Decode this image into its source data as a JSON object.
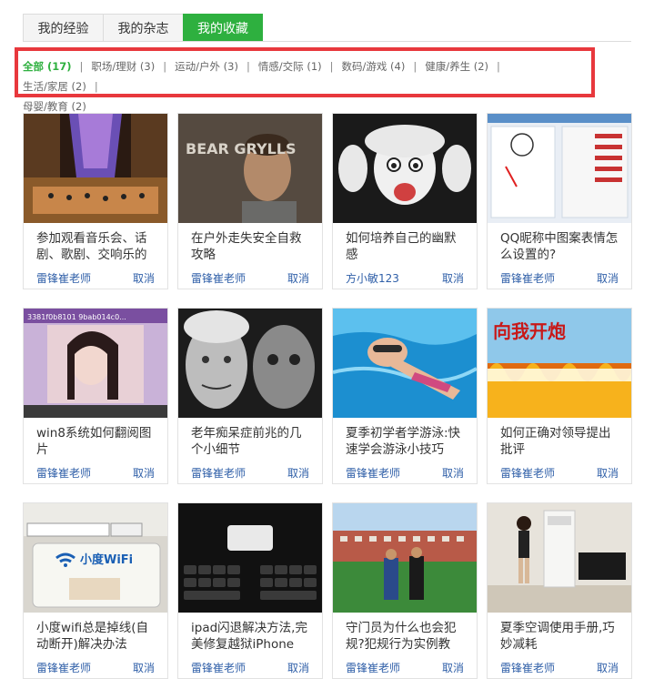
{
  "tabs": [
    {
      "label": "我的经验",
      "active": false
    },
    {
      "label": "我的杂志",
      "active": false
    },
    {
      "label": "我的收藏",
      "active": true
    }
  ],
  "categories": [
    {
      "label": "全部 (17)",
      "active": true
    },
    {
      "label": "职场/理财 (3)"
    },
    {
      "label": "运动/户外 (3)"
    },
    {
      "label": "情感/交际 (1)"
    },
    {
      "label": "数码/游戏 (4)"
    },
    {
      "label": "健康/养生 (2)"
    },
    {
      "label": "生活/家居 (2)"
    },
    {
      "label": "母婴/教育 (2)"
    }
  ],
  "cards": [
    {
      "title": "参加观看音乐会、话剧、歌剧、交响乐的",
      "author": "雷锋崔老师",
      "cancel": "取消",
      "thumb": "concert-photo"
    },
    {
      "title": "在户外走失安全自救攻略",
      "author": "雷锋崔老师",
      "cancel": "取消",
      "thumb": "bear-grylls-photo",
      "thumb_text": "BEAR GRYLLS"
    },
    {
      "title": "如何培养自己的幽默感",
      "author": "方小敏123",
      "cancel": "取消",
      "thumb": "einstein-cartoon"
    },
    {
      "title": "QQ昵称中图案表情怎么设置的?",
      "author": "雷锋崔老师",
      "cancel": "取消",
      "thumb": "qq-screenshot"
    },
    {
      "title": "win8系统如何翻阅图片",
      "author": "雷锋崔老师",
      "cancel": "取消",
      "thumb": "win8-photo-viewer",
      "thumb_text": "3381f0b8101 9bab014c0..."
    },
    {
      "title": "老年痴呆症前兆的几个小细节",
      "author": "雷锋崔老师",
      "cancel": "取消",
      "thumb": "elderly-faces-photo"
    },
    {
      "title": "夏季初学者学游泳:快速学会游泳小技巧",
      "author": "雷锋崔老师",
      "cancel": "取消",
      "thumb": "swimmer-photo"
    },
    {
      "title": "如何正确对领导提出批评",
      "author": "雷锋崔老师",
      "cancel": "取消",
      "thumb": "fire-banner",
      "thumb_text": "向我开炮"
    },
    {
      "title": "小度wifi总是掉线(自动断开)解决办法",
      "author": "雷锋崔老师",
      "cancel": "取消",
      "thumb": "xiaodu-wifi-photo",
      "thumb_text": "小度WiFi"
    },
    {
      "title": "ipad闪退解决方法,完美修复越狱iPhone",
      "author": "雷锋崔老师",
      "cancel": "取消",
      "thumb": "ipad-keyboard-screenshot"
    },
    {
      "title": "守门员为什么也会犯规?犯规行为实例教",
      "author": "雷锋崔老师",
      "cancel": "取消",
      "thumb": "soccer-field-photo"
    },
    {
      "title": "夏季空调使用手册,巧妙减耗",
      "author": "雷锋崔老师",
      "cancel": "取消",
      "thumb": "air-conditioner-photo"
    }
  ],
  "colors": {
    "accent": "#2eb03f",
    "highlight_box": "#e8383d",
    "link": "#2f5fa8"
  }
}
